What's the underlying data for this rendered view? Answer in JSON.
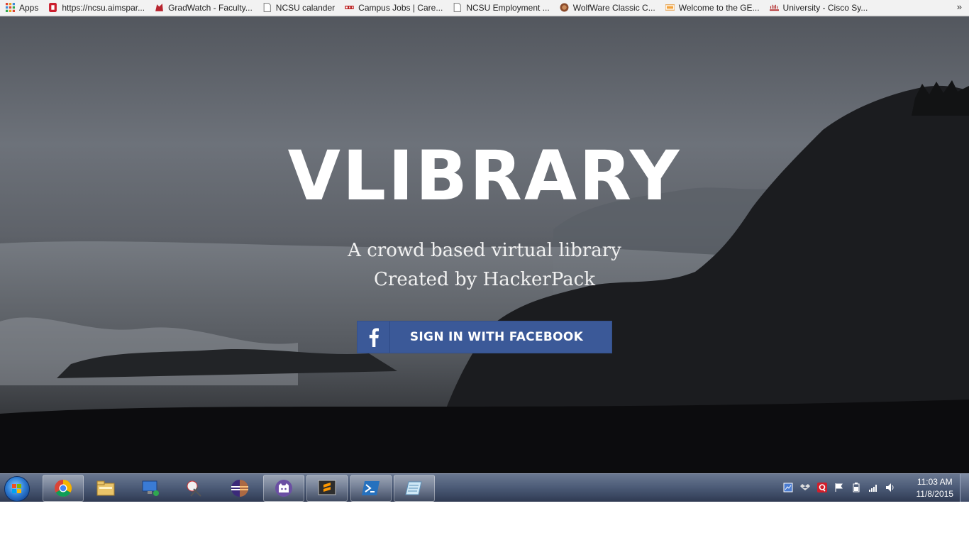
{
  "bookmarks": [
    {
      "label": "Apps",
      "icon": "apps-grid-icon"
    },
    {
      "label": "https://ncsu.aimspar...",
      "icon": "ncsu-icon"
    },
    {
      "label": "GradWatch - Faculty...",
      "icon": "wolf-icon"
    },
    {
      "label": "NCSU calander",
      "icon": "page-icon"
    },
    {
      "label": "Campus Jobs | Care...",
      "icon": "cdc-icon"
    },
    {
      "label": "NCSU Employment ...",
      "icon": "page-icon"
    },
    {
      "label": "WolfWare Classic C...",
      "icon": "wolfware-icon"
    },
    {
      "label": "Welcome to the GE...",
      "icon": "gem-icon"
    },
    {
      "label": "University - Cisco Sy...",
      "icon": "cisco-icon"
    }
  ],
  "bookmarks_more": "»",
  "hero": {
    "title": "VLIBRARY",
    "subtitle_1": "A crowd based virtual library",
    "subtitle_2": "Created by HackerPack",
    "facebook_button": "SIGN IN WITH FACEBOOK",
    "facebook_color": "#3b5998"
  },
  "taskbar": {
    "apps": [
      "chrome-icon",
      "file-explorer-icon",
      "remote-desktop-icon",
      "snipping-tool-icon",
      "eclipse-icon",
      "github-icon",
      "sublime-text-icon",
      "powershell-icon",
      "notepad-icon"
    ],
    "clock_time": "11:03 AM",
    "clock_date": "11/8/2015"
  }
}
